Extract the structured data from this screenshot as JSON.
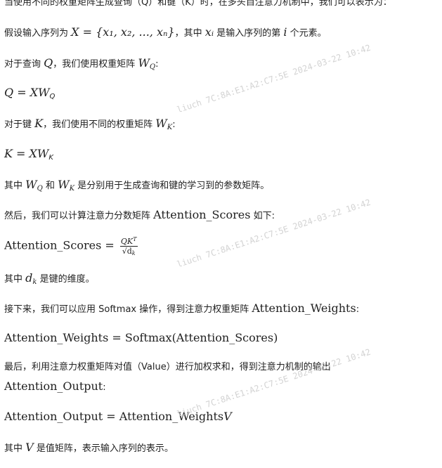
{
  "lines": {
    "l0": "当使用不同的权重矩阵生成查询（Q）和键（K）时，在多头自注意力机制中，我们可以表示为：",
    "l1_a": "假设输入序列为",
    "l1_m": "X = {x₁, x₂, ..., xₙ}",
    "l1_b": "，其中",
    "l1_xi": "xᵢ",
    "l1_c": "是输入序列的第",
    "l1_i": "i",
    "l1_d": "个元素。",
    "l2_a": "对于查询",
    "l2_q": "Q",
    "l2_b": "，我们使用权重矩阵",
    "l2_w": "W",
    "l2_wsub": "Q",
    "l2_c": ":",
    "eq1_lhs": "Q = XW",
    "eq1_sub": "Q",
    "l3_a": "对于键",
    "l3_k": "K",
    "l3_b": "，我们使用不同的权重矩阵",
    "l3_w": "W",
    "l3_wsub": "K",
    "l3_c": ":",
    "eq2_lhs": "K = XW",
    "eq2_sub": "K",
    "l4_a": "其中",
    "l4_w1": "W",
    "l4_w1sub": "Q",
    "l4_b": "和",
    "l4_w2": "W",
    "l4_w2sub": "K",
    "l4_c": "是分别用于生成查询和键的学习到的参数矩阵。",
    "l5_a": "然后，我们可以计算注意力分数矩阵",
    "l5_m": "Attention_Scores",
    "l5_b": "如下:",
    "eq3_lhs": "Attention_Scores =",
    "eq3_num": "QK",
    "eq3_sup": "T",
    "eq3_den": "√d",
    "eq3_densub": "k",
    "l6_a": "其中",
    "l6_d": "d",
    "l6_dsub": "k",
    "l6_b": "是键的维度。",
    "l7_a": "接下来，我们可以应用 Softmax 操作，得到注意力权重矩阵",
    "l7_m": "Attention_Weights",
    "l7_b": ":",
    "eq4": "Attention_Weights = Softmax(Attention_Scores)",
    "l8_a": "最后，利用注意力权重矩阵对值（Value）进行加权求和，得到注意力机制的输出",
    "l8_m": "Attention_Output",
    "l8_b": ":",
    "eq5_a": "Attention_Output = Attention_Weights",
    "eq5_v": "V",
    "l9_a": "其中",
    "l9_v": "V",
    "l9_b": "是值矩阵，表示输入序列的表示。"
  },
  "watermark": "liuch 7C:8A:E1:A2:C7:5E 2024-03-22 10:42"
}
